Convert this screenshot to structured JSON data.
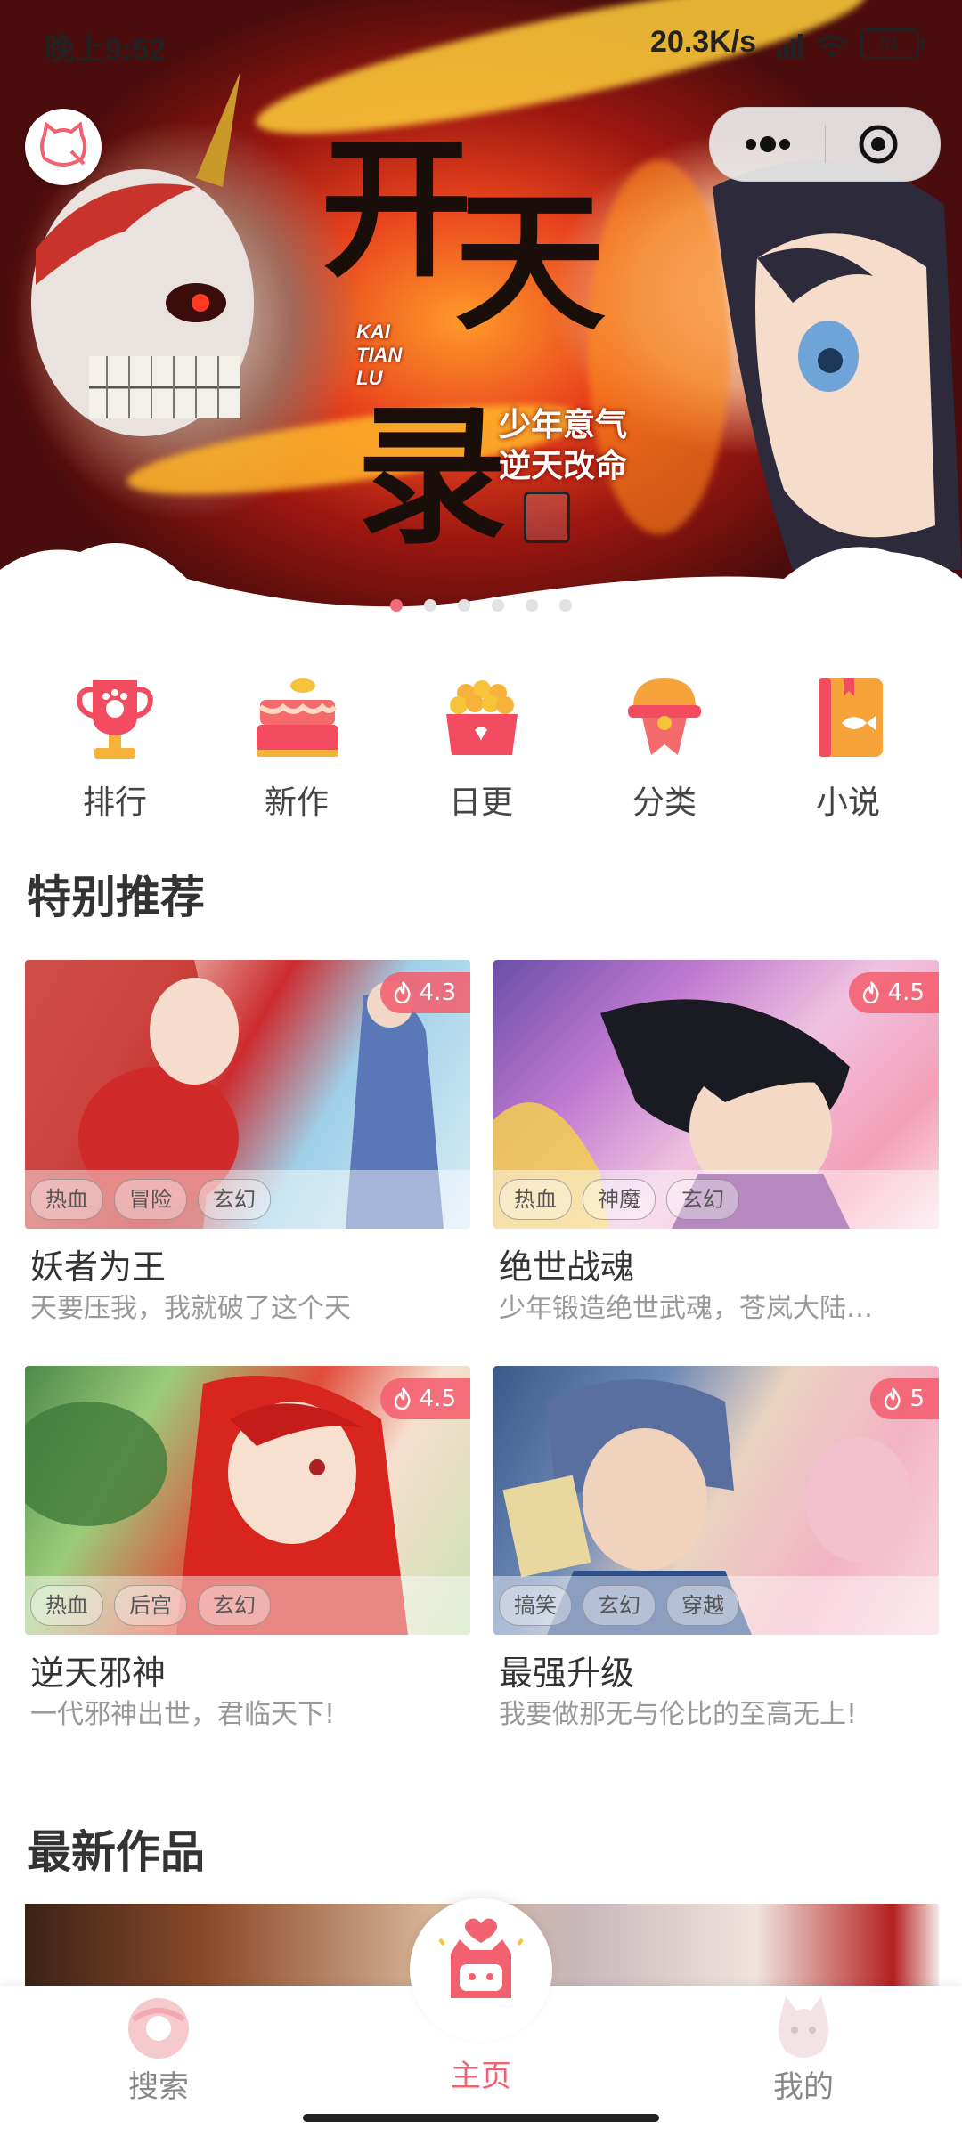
{
  "status_bar": {
    "time": "晚上9:52",
    "network_speed": "20.3K/s",
    "battery": "51"
  },
  "banner": {
    "title_chars": [
      "开",
      "天",
      "录"
    ],
    "pinyin": "KAI\nTIAN\nLU",
    "slogan_line1": "少年意气",
    "slogan_line2": "逆天改命",
    "slide_count": 6,
    "active_slide": 1
  },
  "quick_entries": [
    {
      "label": "排行",
      "icon": "trophy-icon"
    },
    {
      "label": "新作",
      "icon": "cake-icon"
    },
    {
      "label": "日更",
      "icon": "gift-basket-icon"
    },
    {
      "label": "分类",
      "icon": "badge-icon"
    },
    {
      "label": "小说",
      "icon": "book-icon"
    }
  ],
  "recommend": {
    "title": "特别推荐",
    "items": [
      {
        "title": "妖者为王",
        "desc": "天要压我，我就破了这个天",
        "score": "4.3",
        "tags": [
          "热血",
          "冒险",
          "玄幻"
        ]
      },
      {
        "title": "绝世战魂",
        "desc": "少年锻造绝世武魂，苍岚大陆…",
        "score": "4.5",
        "tags": [
          "热血",
          "神魔",
          "玄幻"
        ]
      },
      {
        "title": "逆天邪神",
        "desc": "一代邪神出世，君临天下!",
        "score": "4.5",
        "tags": [
          "热血",
          "后宫",
          "玄幻"
        ]
      },
      {
        "title": "最强升级",
        "desc": "我要做那无与伦比的至高无上!",
        "score": "5",
        "tags": [
          "搞笑",
          "玄幻",
          "穿越"
        ]
      }
    ]
  },
  "latest": {
    "title": "最新作品"
  },
  "tabbar": {
    "search": "搜索",
    "home": "主页",
    "mine": "我的",
    "active": "home"
  },
  "colors": {
    "accent": "#f1616f",
    "score_bg": "#f45c6c",
    "dot_active": "#f16a7a"
  }
}
